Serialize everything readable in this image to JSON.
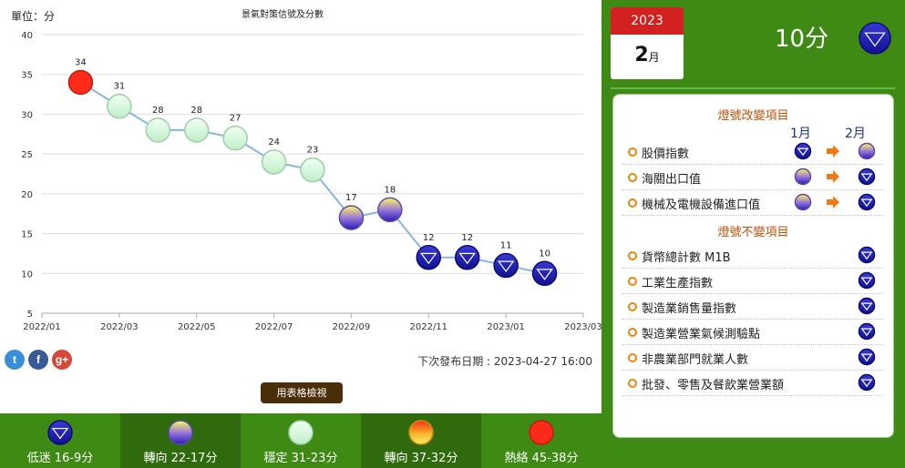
{
  "chart_data": {
    "type": "line",
    "title": "景氣對策信號及分數",
    "ylabel": "單位：分",
    "ylim": [
      5,
      40
    ],
    "yticks": [
      5,
      10,
      15,
      20,
      25,
      30,
      35,
      40
    ],
    "xticks": [
      "2022/01",
      "2022/03",
      "2022/05",
      "2022/07",
      "2022/09",
      "2022/11",
      "2023/01",
      "2023/03"
    ],
    "grid": true,
    "series": [
      {
        "x": [
          "2022/02",
          "2022/03",
          "2022/04",
          "2022/05",
          "2022/06",
          "2022/07",
          "2022/08",
          "2022/09",
          "2022/10",
          "2022/11",
          "2022/12",
          "2023/01",
          "2023/02"
        ],
        "values": [
          34,
          31,
          28,
          28,
          27,
          24,
          23,
          17,
          18,
          12,
          12,
          11,
          10
        ],
        "signals": [
          "hot",
          "stable",
          "stable",
          "stable",
          "stable",
          "stable",
          "stable",
          "toward",
          "toward",
          "slow",
          "slow",
          "slow",
          "slow"
        ]
      }
    ]
  },
  "colors": {
    "hot": "#ff2a1a",
    "toward_hot": "#f5a623",
    "stable": "#c9f0d2",
    "toward": "#6a3fd0",
    "slow": "#1a1ab8",
    "line": "#88b4e0",
    "panel_green": "#3f8a15"
  },
  "social": [
    {
      "name": "twitter",
      "glyph": "t"
    },
    {
      "name": "facebook",
      "glyph": "f"
    },
    {
      "name": "google-plus",
      "glyph": "g+"
    }
  ],
  "next_release": "下次發布日期 : 2023-04-27 16:00",
  "table_button": "用表格檢視",
  "legend": [
    {
      "signal": "slow",
      "label": "低迷 16-9分"
    },
    {
      "signal": "toward",
      "label": "轉向 22-17分"
    },
    {
      "signal": "stable",
      "label": "穩定 31-23分"
    },
    {
      "signal": "toward_hot",
      "label": "轉向 37-32分"
    },
    {
      "signal": "hot",
      "label": "熱絡 45-38分"
    }
  ],
  "current": {
    "year": "2023",
    "month": "2",
    "month_unit": "月",
    "score": "10分",
    "signal": "slow"
  },
  "changes": {
    "changed_title": "燈號改變項目",
    "col_prev": "1月",
    "col_curr": "2月",
    "changed": [
      {
        "name": "股價指數",
        "prev": "slow",
        "curr": "toward"
      },
      {
        "name": "海關出口值",
        "prev": "toward",
        "curr": "slow"
      },
      {
        "name": "機械及電機設備進口值",
        "prev": "toward",
        "curr": "slow"
      }
    ],
    "unchanged_title": "燈號不變項目",
    "unchanged": [
      {
        "name": "貨幣總計數 M1B",
        "curr": "slow"
      },
      {
        "name": "工業生產指數",
        "curr": "slow"
      },
      {
        "name": "製造業銷售量指數",
        "curr": "slow"
      },
      {
        "name": "製造業營業氣候測驗點",
        "curr": "slow"
      },
      {
        "name": "非農業部門就業人數",
        "curr": "slow"
      },
      {
        "name": "批發、零售及餐飲業營業額",
        "curr": "slow"
      }
    ]
  }
}
